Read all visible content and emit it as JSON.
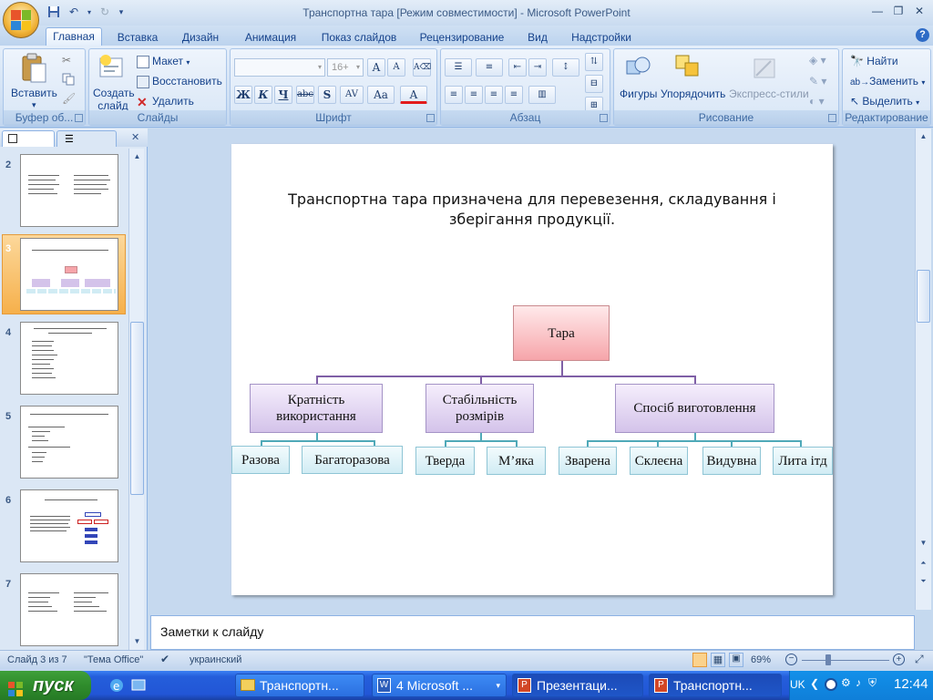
{
  "window": {
    "title": "Транспортна тара [Режим совместимости] - Microsoft PowerPoint"
  },
  "ribbon": {
    "tabs": [
      "Главная",
      "Вставка",
      "Дизайн",
      "Анимация",
      "Показ слайдов",
      "Рецензирование",
      "Вид",
      "Надстройки"
    ],
    "active_tab": "Главная",
    "groups": {
      "clipboard": {
        "label": "Буфер об...",
        "paste": "Вставить"
      },
      "slides": {
        "label": "Слайды",
        "new_slide": "Создать слайд",
        "layout": "Макет",
        "reset": "Восстановить",
        "delete": "Удалить"
      },
      "font": {
        "label": "Шрифт",
        "size": "16+",
        "bold": "Ж",
        "italic": "К",
        "underline": "Ч",
        "strike": "abc",
        "shadow": "S",
        "spacing": "AV",
        "case": "Aa",
        "color": "A",
        "grow": "A",
        "shrink": "A"
      },
      "paragraph": {
        "label": "Абзац"
      },
      "drawing": {
        "label": "Рисование",
        "shapes": "Фигуры",
        "arrange": "Упорядочить",
        "quick_styles": "Экспресс-стили"
      },
      "editing": {
        "label": "Редактирование",
        "find": "Найти",
        "replace": "Заменить",
        "select": "Выделить"
      }
    }
  },
  "slides_pane": {
    "thumbnails": [
      {
        "number": "2"
      },
      {
        "number": "3",
        "selected": true
      },
      {
        "number": "4"
      },
      {
        "number": "5"
      },
      {
        "number": "6"
      },
      {
        "number": "7"
      }
    ]
  },
  "slide": {
    "text": "Транспортна тара призначена для перевезення, складування і зберігання продукції.",
    "root": "Тара",
    "branches": [
      {
        "label": "Кратність використання",
        "children": [
          "Разова",
          "Багаторазова"
        ]
      },
      {
        "label": "Стабільність розмірів",
        "children": [
          "Тверда",
          "М’яка"
        ]
      },
      {
        "label": "Спосіб виготовлення",
        "children": [
          "Зварена",
          "Склеєна",
          "Видувна",
          "Лита ітд"
        ]
      }
    ]
  },
  "notes": {
    "text": "Заметки к слайду"
  },
  "status": {
    "slide_info": "Слайд 3 из 7",
    "theme": "\"Тема Office\"",
    "language": "украинский",
    "zoom": "69%"
  },
  "taskbar": {
    "start": "пуск",
    "tasks": [
      "Транспортн...",
      "4 Microsoft ...",
      "Презентаци...",
      "Транспортн..."
    ],
    "lang": "UK",
    "clock": "12:44"
  },
  "colors": {
    "root_fill": "#f6a5aa",
    "mid_fill": "#d4c3ea",
    "leaf_fill": "#d1ecf4",
    "connector_mid": "#7f5fa6",
    "connector_leaf": "#4fa9b8",
    "thumb_selected": "#f3a43b"
  }
}
